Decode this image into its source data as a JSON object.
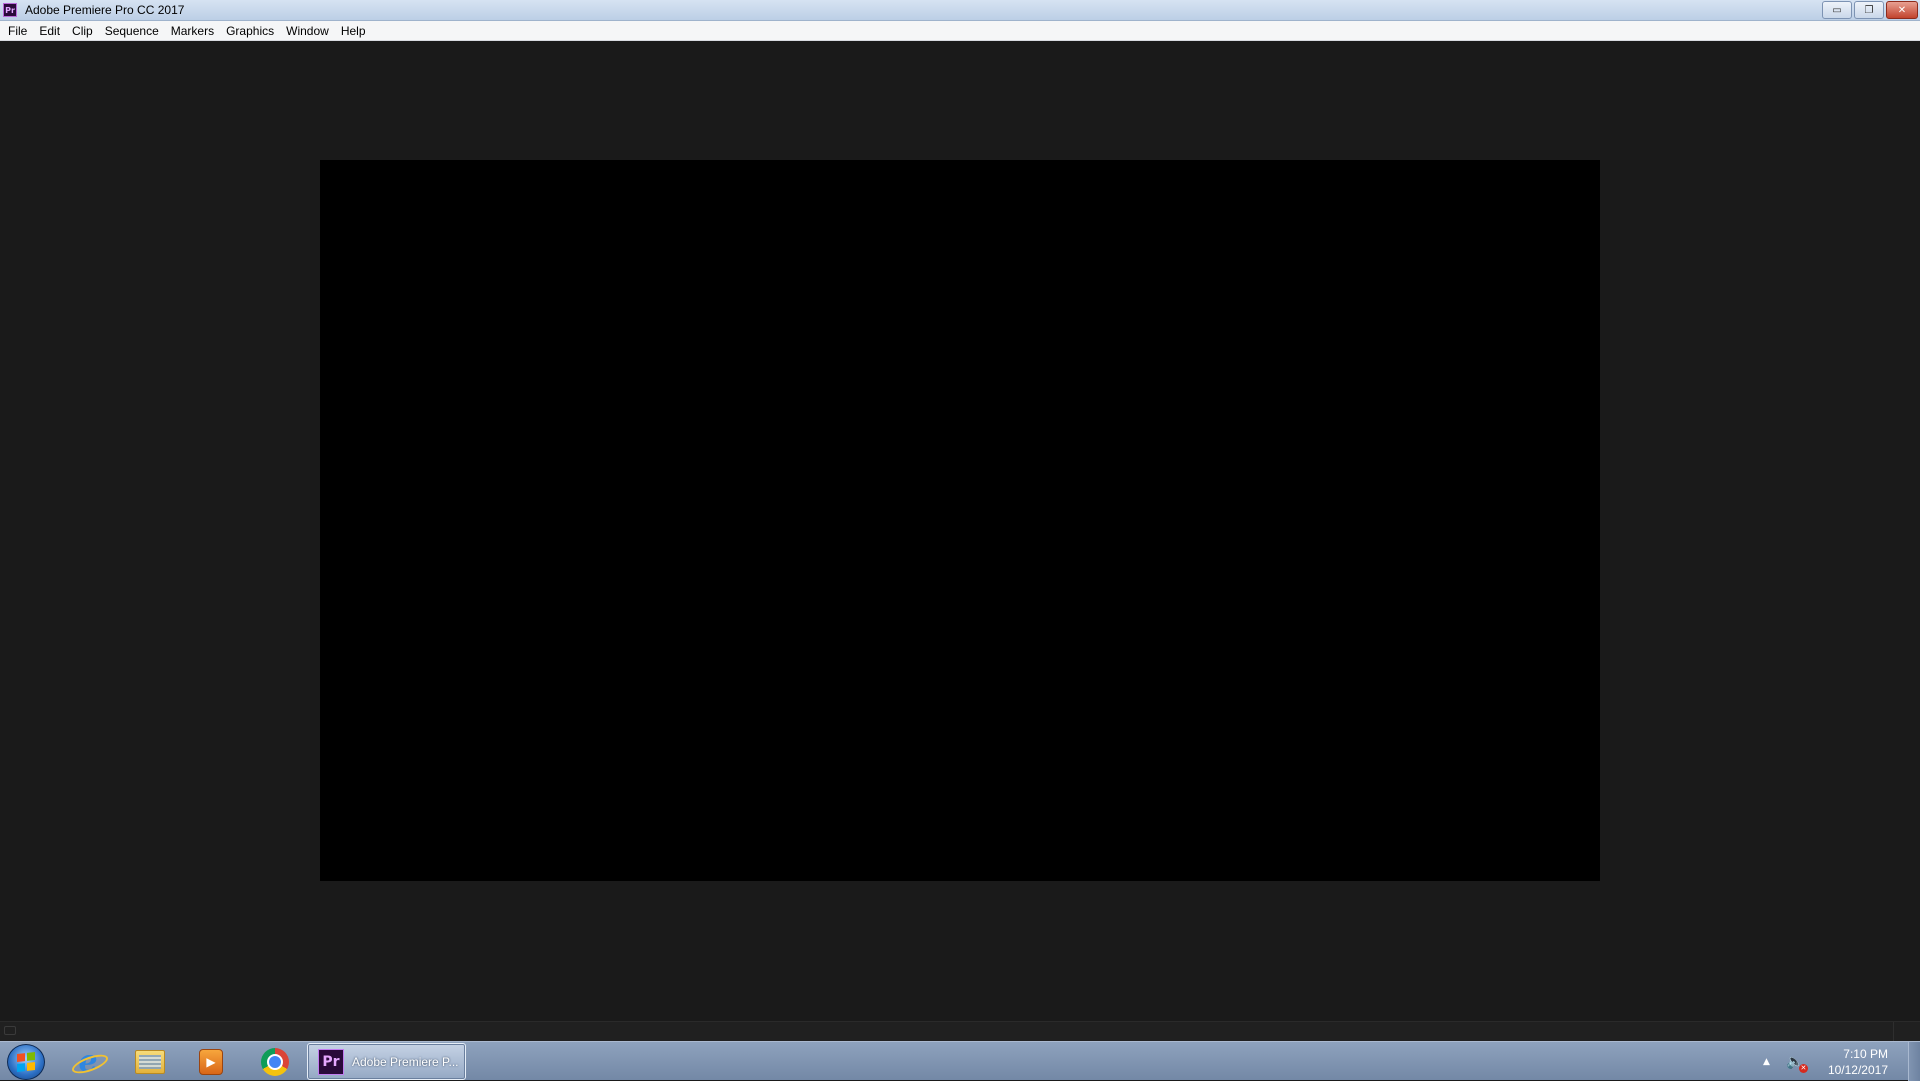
{
  "window": {
    "title": "Adobe Premiere Pro CC 2017",
    "app_icon": "Pr",
    "controls": {
      "minimize": "▭",
      "restore": "❐",
      "close": "✕"
    }
  },
  "menu": {
    "items": [
      "File",
      "Edit",
      "Clip",
      "Sequence",
      "Markers",
      "Graphics",
      "Window",
      "Help"
    ]
  },
  "taskbar": {
    "pinned": [
      {
        "name": "internet-explorer-icon",
        "glyph": "e"
      },
      {
        "name": "windows-explorer-icon"
      },
      {
        "name": "media-player-icon",
        "glyph": "▶"
      },
      {
        "name": "chrome-icon"
      }
    ],
    "active_task": {
      "icon": "Pr",
      "label": "Adobe Premiere P..."
    },
    "tray": {
      "arrow": "▲",
      "volume_glyph": "🔈",
      "mute_glyph": "✕",
      "time": "7:10 PM",
      "date": "10/12/2017"
    }
  },
  "colors": {
    "workspace_bg": "#1a1a1a",
    "program_frame": "#000000",
    "premiere_purple": "#2a0a3a"
  }
}
